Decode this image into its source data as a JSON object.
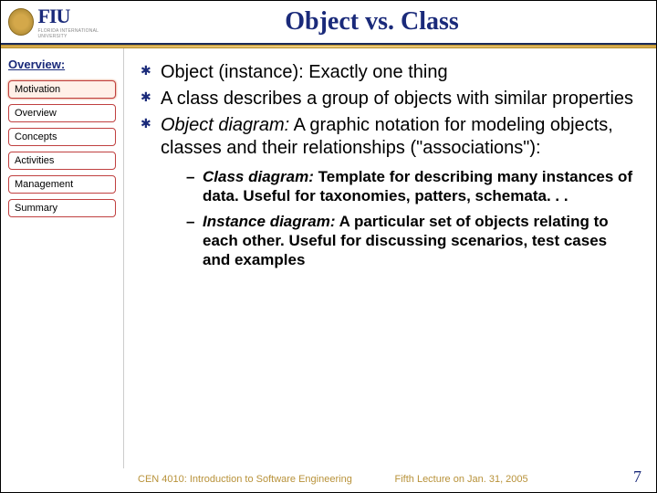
{
  "header": {
    "logo_text": "FIU",
    "logo_subtext": "FLORIDA INTERNATIONAL UNIVERSITY",
    "title": "Object vs. Class"
  },
  "sidebar": {
    "heading": "Overview:",
    "items": [
      {
        "label": "Motivation",
        "active": true
      },
      {
        "label": "Overview",
        "active": false
      },
      {
        "label": "Concepts",
        "active": false
      },
      {
        "label": "Activities",
        "active": false
      },
      {
        "label": "Management",
        "active": false
      },
      {
        "label": "Summary",
        "active": false
      }
    ]
  },
  "content": {
    "bullets": [
      {
        "lead": "",
        "text": "Object (instance): Exactly one thing"
      },
      {
        "lead": "",
        "text": "A class describes a group of objects with similar properties"
      },
      {
        "lead_italic": "Object diagram:",
        "text": " A graphic notation for modeling objects, classes and their relationships (\"associations\"):"
      }
    ],
    "sub_bullets": [
      {
        "lead": "Class diagram:",
        "rest": " Template for describing many instances of data. Useful for taxonomies, patters, schemata. . ."
      },
      {
        "lead": "Instance diagram:",
        "rest": " A particular set of objects relating to each other. Useful for discussing scenarios, test cases and examples"
      }
    ]
  },
  "footer": {
    "left": "CEN 4010: Introduction to Software Engineering",
    "mid": "Fifth Lecture on Jan. 31, 2005",
    "page": "7"
  }
}
